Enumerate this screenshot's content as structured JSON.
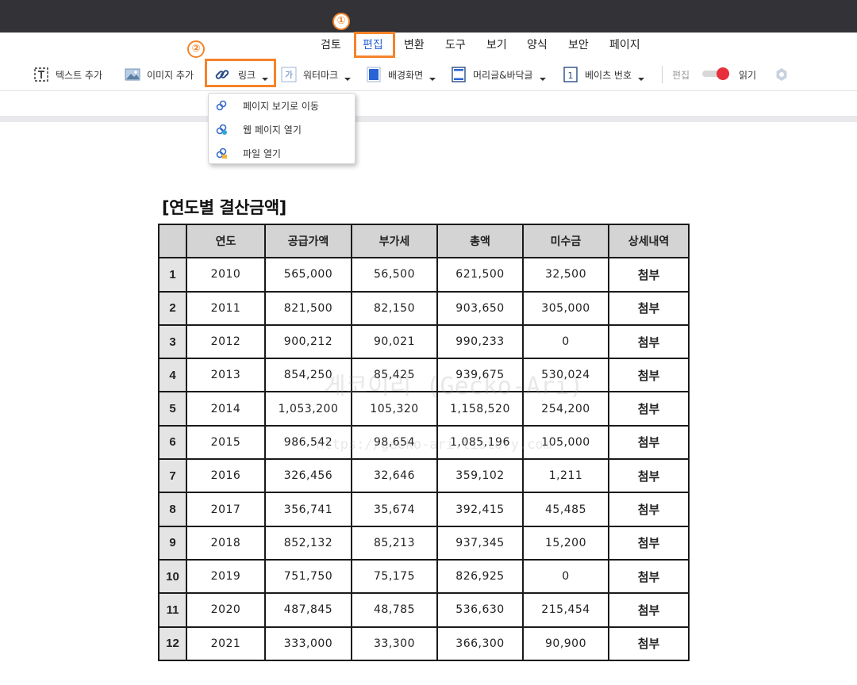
{
  "menubar": {
    "items": [
      {
        "label": "검토"
      },
      {
        "label": "편집"
      },
      {
        "label": "변환"
      },
      {
        "label": "도구"
      },
      {
        "label": "보기"
      },
      {
        "label": "양식"
      },
      {
        "label": "보안"
      },
      {
        "label": "페이지"
      }
    ],
    "active_index": 1
  },
  "annotations": {
    "badge1": "①",
    "badge2": "②",
    "highlight_color": "#f5832a"
  },
  "toolbar": {
    "add_text": {
      "label": "텍스트 추가",
      "icon": "text-box-icon"
    },
    "add_image": {
      "label": "이미지 추가",
      "icon": "image-icon"
    },
    "link": {
      "label": "링크",
      "icon": "link-icon"
    },
    "watermark": {
      "label": "워터마크",
      "icon": "watermark-icon"
    },
    "background": {
      "label": "배경화면",
      "icon": "background-icon"
    },
    "header_footer": {
      "label": "머리글&바닥글",
      "icon": "header-footer-icon"
    },
    "bates": {
      "label": "베이츠 번호",
      "icon": "bates-number-icon"
    },
    "mode_edit": "편집",
    "mode_read": "읽기",
    "toggle_color": "#e8303c"
  },
  "link_menu": {
    "items": [
      {
        "label": "페이지 보기로 이동",
        "icon": "page-link-icon"
      },
      {
        "label": "웹 페이지 열기",
        "icon": "web-link-icon"
      },
      {
        "label": "파일 열기",
        "icon": "file-link-icon"
      }
    ]
  },
  "document": {
    "title": "[연도별 결산금액]",
    "watermark_line1": "게코이리 (Gecko-Ari)",
    "watermark_line2": "https://gecko-ari.tistory.com",
    "table": {
      "headers": [
        "",
        "연도",
        "공급가액",
        "부가세",
        "총액",
        "미수금",
        "상세내역"
      ],
      "rows": [
        [
          "1",
          "2010",
          "565,000",
          "56,500",
          "621,500",
          "32,500",
          "첨부"
        ],
        [
          "2",
          "2011",
          "821,500",
          "82,150",
          "903,650",
          "305,000",
          "첨부"
        ],
        [
          "3",
          "2012",
          "900,212",
          "90,021",
          "990,233",
          "0",
          "첨부"
        ],
        [
          "4",
          "2013",
          "854,250",
          "85,425",
          "939,675",
          "530,024",
          "첨부"
        ],
        [
          "5",
          "2014",
          "1,053,200",
          "105,320",
          "1,158,520",
          "254,200",
          "첨부"
        ],
        [
          "6",
          "2015",
          "986,542",
          "98,654",
          "1,085,196",
          "105,000",
          "첨부"
        ],
        [
          "7",
          "2016",
          "326,456",
          "32,646",
          "359,102",
          "1,211",
          "첨부"
        ],
        [
          "8",
          "2017",
          "356,741",
          "35,674",
          "392,415",
          "45,485",
          "첨부"
        ],
        [
          "9",
          "2018",
          "852,132",
          "85,213",
          "937,345",
          "15,200",
          "첨부"
        ],
        [
          "10",
          "2019",
          "751,750",
          "75,175",
          "826,925",
          "0",
          "첨부"
        ],
        [
          "11",
          "2020",
          "487,845",
          "48,785",
          "536,630",
          "215,454",
          "첨부"
        ],
        [
          "12",
          "2021",
          "333,000",
          "33,300",
          "366,300",
          "90,900",
          "첨부"
        ]
      ]
    }
  }
}
